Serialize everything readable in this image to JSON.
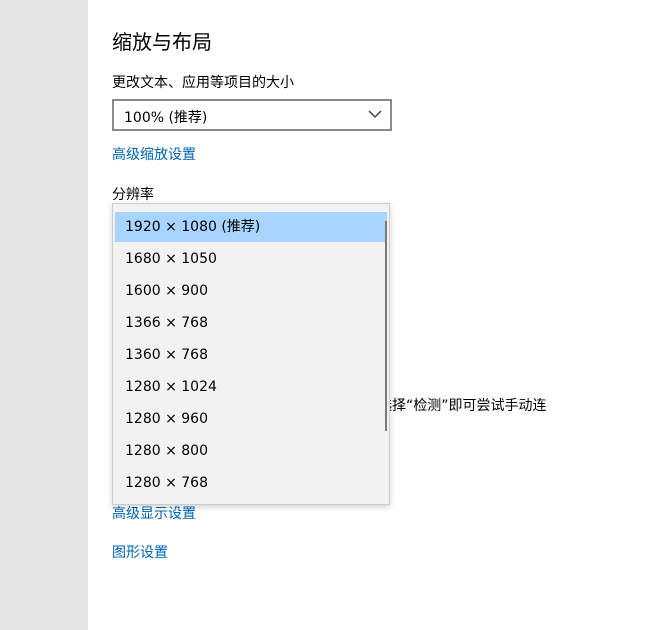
{
  "section": {
    "title": "缩放与布局"
  },
  "scale": {
    "label": "更改文本、应用等项目的大小",
    "selected_value": "100% (推荐)",
    "advanced_link": "高级缩放设置"
  },
  "resolution": {
    "label": "分辨率",
    "options": [
      "1920 × 1080 (推荐)",
      "1680 × 1050",
      "1600 × 900",
      "1366 × 768",
      "1360 × 768",
      "1280 × 1024",
      "1280 × 960",
      "1280 × 800",
      "1280 × 768"
    ],
    "selected_index": 0
  },
  "partial_text": "选择“检测”即可尝试手动连",
  "links": {
    "advanced_display": "高级显示设置",
    "graphics": "图形设置"
  },
  "colors": {
    "link": "#0063b1",
    "selected_item": "#a8d5ff",
    "sidebar": "#e6e6e6",
    "dropdown_bg": "#f2f2f2"
  }
}
